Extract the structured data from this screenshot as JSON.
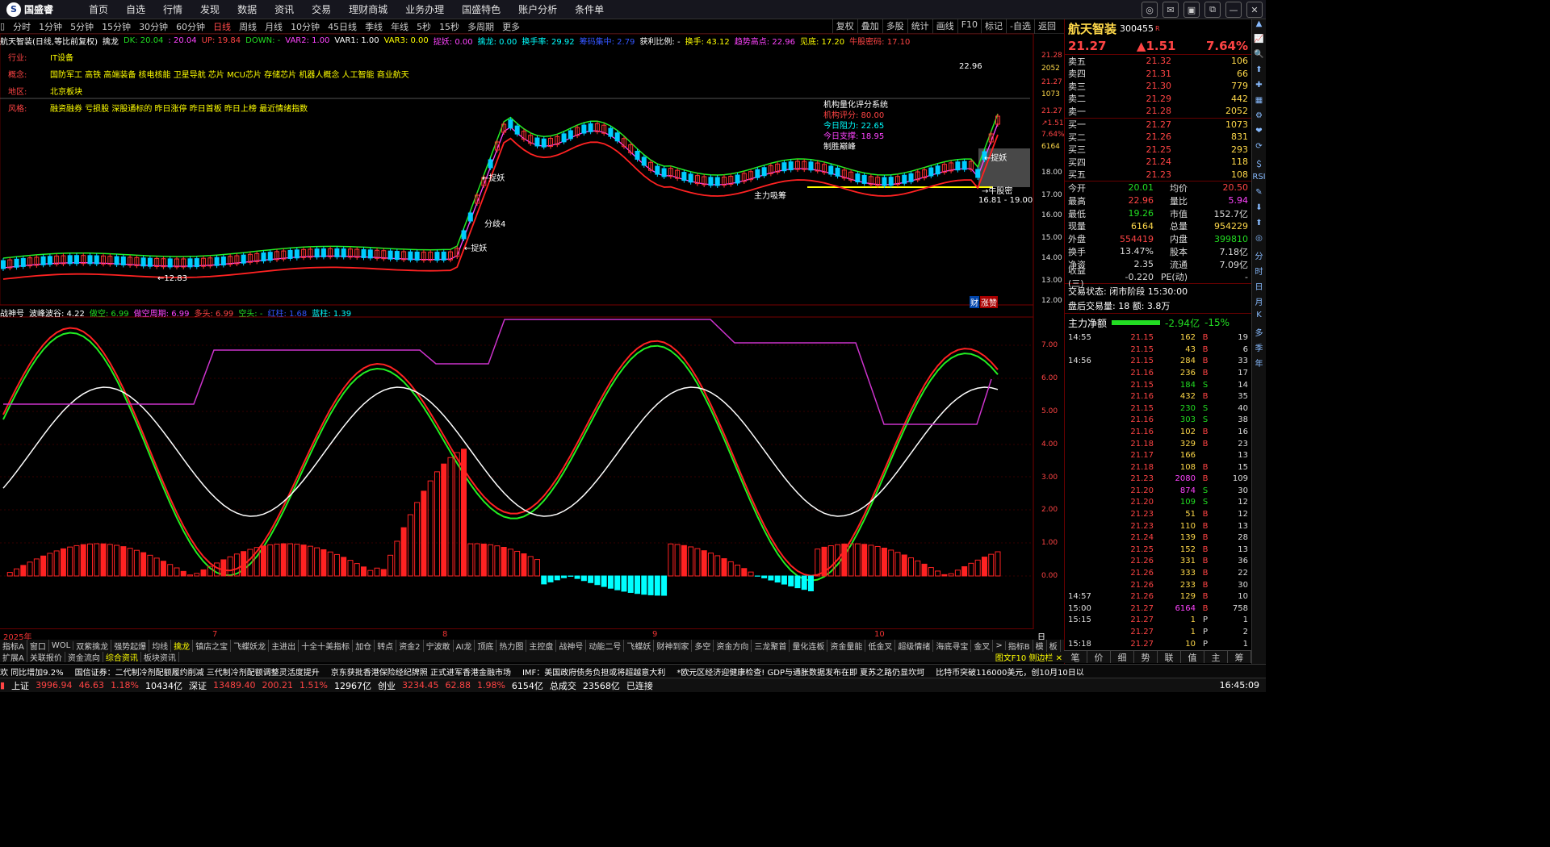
{
  "app": {
    "logo_text": "国盛睿"
  },
  "menu": [
    "首页",
    "自选",
    "行情",
    "发现",
    "数据",
    "资讯",
    "交易",
    "理财商城",
    "业务办理",
    "国盛特色",
    "账户分析",
    "条件单"
  ],
  "window_buttons": [
    "◎",
    "✉",
    "▣",
    "⧉",
    "—",
    "✕"
  ],
  "periods": [
    "分时",
    "1分钟",
    "5分钟",
    "15分钟",
    "30分钟",
    "60分钟",
    "日线",
    "周线",
    "月线",
    "10分钟",
    "45日线",
    "季线",
    "年线",
    "5秒",
    "15秒",
    "多周期",
    "更多"
  ],
  "period_active": "日线",
  "right_tools": [
    "复权",
    "叠加",
    "多股",
    "统计",
    "画线",
    "F10",
    "标记",
    "-自选",
    "返回"
  ],
  "indicator1": [
    {
      "t": "航天智装(日线,等比前复权)",
      "c": "#ffffff"
    },
    {
      "t": "擒龙",
      "c": "#ffffff"
    },
    {
      "t": "DK: 20.04",
      "c": "#22dd22"
    },
    {
      "t": ": 20.04",
      "c": "#ff44ff"
    },
    {
      "t": "UP: 19.84",
      "c": "#ff4444"
    },
    {
      "t": "DOWN: -",
      "c": "#22dd22"
    },
    {
      "t": "VAR2: 1.00",
      "c": "#ff44ff"
    },
    {
      "t": "VAR1: 1.00",
      "c": "#ffffff"
    },
    {
      "t": "VAR3: 0.00",
      "c": "#ffff00"
    },
    {
      "t": "捉妖: 0.00",
      "c": "#ff44ff"
    },
    {
      "t": "擒龙: 0.00",
      "c": "#00ffff"
    },
    {
      "t": "换手率: 29.92",
      "c": "#00ffff"
    },
    {
      "t": "筹码集中: 2.79",
      "c": "#3355ff"
    },
    {
      "t": "获利比例: -",
      "c": "#ffffff"
    },
    {
      "t": "换手: 43.12",
      "c": "#ffff00"
    },
    {
      "t": "趋势高点: 22.96",
      "c": "#ff44ff"
    },
    {
      "t": "见底: 17.20",
      "c": "#ffff00"
    },
    {
      "t": "牛股密码: 17.10",
      "c": "#ff4444"
    }
  ],
  "info": [
    {
      "k": "行业:",
      "v": "IT设备"
    },
    {
      "k": "概念:",
      "v": "国防军工 高铁 高端装备 核电核能 卫星导航 芯片 MCU芯片 存储芯片 机器人概念 人工智能 商业航天"
    },
    {
      "k": "地区:",
      "v": "北京板块"
    },
    {
      "k": "风格:",
      "v": "融资融券 亏损股 深股通标的 昨日涨停 昨日首板 昨日上榜 最近情绪指数"
    }
  ],
  "score": {
    "title": "机构量化评分系统",
    "rows": [
      {
        "k": "机构评分:",
        "v": "80.00",
        "c": "#ff4444"
      },
      {
        "k": "今日阻力:",
        "v": "22.65",
        "c": "#00ffff"
      },
      {
        "k": "今日支撑:",
        "v": "18.95",
        "c": "#ff44ff"
      }
    ],
    "footer": "制胜巅峰"
  },
  "chart_labels": {
    "zhuoyao": "←捉妖",
    "fenqi": "分歧4",
    "zhuli": "主力吸筹",
    "niugu": "→牛股密",
    "range": "16.81 - 19.00",
    "low": "←12.83",
    "high": "22.96",
    "cai": "财",
    "zhang": "涨赞"
  },
  "price_axis": [
    "21.28",
    "2052",
    "21.27",
    "1073",
    "21.27",
    "↗1.51",
    "7.64%",
    "6164",
    "18.00",
    "17.00",
    "16.00",
    "15.00",
    "14.00",
    "13.00",
    "12.00"
  ],
  "indicator2": [
    {
      "t": "战神号",
      "c": "#ffffff"
    },
    {
      "t": "波峰波谷: 4.22",
      "c": "#ffffff"
    },
    {
      "t": "做空: 6.99",
      "c": "#22dd22"
    },
    {
      "t": "做空周期: 6.99",
      "c": "#ff44ff"
    },
    {
      "t": "多头: 6.99",
      "c": "#ff4444"
    },
    {
      "t": "空头: -",
      "c": "#22dd22"
    },
    {
      "t": "红柱: 1.68",
      "c": "#3355ff"
    },
    {
      "t": "蓝柱: 1.39",
      "c": "#00ffff"
    }
  ],
  "sub_axis": [
    "7.00",
    "6.00",
    "5.00",
    "4.00",
    "3.00",
    "2.00",
    "1.00",
    "0.00"
  ],
  "date_axis": [
    "2025年",
    "7",
    "8",
    "9",
    "10"
  ],
  "date_axis_right": "日线",
  "tabs1": [
    "指标A",
    "窗口",
    "WOL",
    "双紫擒龙",
    "强势起爆",
    "均线",
    "擒龙",
    "镇店之宝",
    "飞蝶妖龙",
    "主进出",
    "十全十美指标",
    "加仓",
    "转点",
    "资金2",
    "宁波敢",
    "AI龙",
    "顶底",
    "热力图",
    "主控盘",
    "战神号",
    "动能二号",
    "飞蝶妖",
    "财神到家",
    "多空",
    "资金方向",
    "三龙聚首",
    "量化连板",
    "资金量能",
    "低金叉",
    "超级情绪",
    "海底寻宝",
    "金叉",
    ">",
    "指标B",
    "模",
    "板"
  ],
  "tabs1_active": "擒龙",
  "tabs2": [
    "扩展A",
    "关联报价",
    "资金流向",
    "综合资讯",
    "板块资讯"
  ],
  "tabs2_active": "综合资讯",
  "tabs2_right": "图文F10 侧边栏 ✕",
  "news": [
    "欢 同比增加9.2%",
    "国信证券：二代制冷剂配额履约削减 三代制冷剂配额调整灵活度提升",
    "京东获批香港保险经纪牌照 正式进军香港金融市场",
    "IMF：美国政府债务负担或将超越意大利",
    "*欧元区经济迎健康检查! GDP与通胀数据发布在即 夏苏之路仍显坎坷",
    "比特币突破116000美元，创10月10日以"
  ],
  "status": [
    {
      "t": "上证",
      "c": "#fff"
    },
    {
      "t": "3996.94",
      "c": "#ff4444"
    },
    {
      "t": "46.63",
      "c": "#ff4444"
    },
    {
      "t": "1.18%",
      "c": "#ff4444"
    },
    {
      "t": "10434亿",
      "c": "#fff"
    },
    {
      "t": "深证",
      "c": "#fff"
    },
    {
      "t": "13489.40",
      "c": "#ff4444"
    },
    {
      "t": "200.21",
      "c": "#ff4444"
    },
    {
      "t": "1.51%",
      "c": "#ff4444"
    },
    {
      "t": "12967亿",
      "c": "#fff"
    },
    {
      "t": "创业",
      "c": "#fff"
    },
    {
      "t": "3234.45",
      "c": "#ff4444"
    },
    {
      "t": "62.88",
      "c": "#ff4444"
    },
    {
      "t": "1.98%",
      "c": "#ff4444"
    },
    {
      "t": "6154亿",
      "c": "#fff"
    },
    {
      "t": "总成交",
      "c": "#fff"
    },
    {
      "t": "23568亿",
      "c": "#fff"
    },
    {
      "t": "已连接",
      "c": "#fff"
    }
  ],
  "clock": "16:45:09",
  "stock": {
    "name": "航天智装",
    "code": "300455",
    "tag": "R",
    "price": "21.27",
    "change": "▲1.51",
    "pct": "7.64%"
  },
  "sell": [
    {
      "l": "卖五",
      "p": "21.32",
      "v": "106"
    },
    {
      "l": "卖四",
      "p": "21.31",
      "v": "66"
    },
    {
      "l": "卖三",
      "p": "21.30",
      "v": "779"
    },
    {
      "l": "卖二",
      "p": "21.29",
      "v": "442"
    },
    {
      "l": "卖一",
      "p": "21.28",
      "v": "2052"
    }
  ],
  "buy": [
    {
      "l": "买一",
      "p": "21.27",
      "v": "1073"
    },
    {
      "l": "买二",
      "p": "21.26",
      "v": "831"
    },
    {
      "l": "买三",
      "p": "21.25",
      "v": "293"
    },
    {
      "l": "买四",
      "p": "21.24",
      "v": "118"
    },
    {
      "l": "买五",
      "p": "21.23",
      "v": "108"
    }
  ],
  "quote": [
    [
      {
        "t": "今开",
        "c": "#ddd"
      },
      {
        "t": "20.01",
        "c": "#22dd22"
      },
      {
        "t": "均价",
        "c": "#ddd"
      },
      {
        "t": "20.50",
        "c": "#ff4444"
      }
    ],
    [
      {
        "t": "最高",
        "c": "#ddd"
      },
      {
        "t": "22.96",
        "c": "#ff4444"
      },
      {
        "t": "量比",
        "c": "#ddd"
      },
      {
        "t": "5.94",
        "c": "#ff44ff"
      }
    ],
    [
      {
        "t": "最低",
        "c": "#ddd"
      },
      {
        "t": "19.26",
        "c": "#22dd22"
      },
      {
        "t": "市值",
        "c": "#ddd"
      },
      {
        "t": "152.7亿",
        "c": "#ddd"
      }
    ],
    [
      {
        "t": "现量",
        "c": "#ddd"
      },
      {
        "t": "6164",
        "c": "#ffd94a"
      },
      {
        "t": "总量",
        "c": "#ddd"
      },
      {
        "t": "954229",
        "c": "#ffd94a"
      }
    ],
    [
      {
        "t": "外盘",
        "c": "#ddd"
      },
      {
        "t": "554419",
        "c": "#ff4444"
      },
      {
        "t": "内盘",
        "c": "#ddd"
      },
      {
        "t": "399810",
        "c": "#22dd22"
      }
    ],
    [
      {
        "t": "换手",
        "c": "#ddd"
      },
      {
        "t": "13.47%",
        "c": "#ddd"
      },
      {
        "t": "股本",
        "c": "#ddd"
      },
      {
        "t": "7.18亿",
        "c": "#ddd"
      }
    ],
    [
      {
        "t": "净资",
        "c": "#ddd"
      },
      {
        "t": "2.35",
        "c": "#ddd"
      },
      {
        "t": "流通",
        "c": "#ddd"
      },
      {
        "t": "7.09亿",
        "c": "#ddd"
      }
    ],
    [
      {
        "t": "收益(三)",
        "c": "#ddd"
      },
      {
        "t": "-0.220",
        "c": "#ddd"
      },
      {
        "t": "PE(动)",
        "c": "#ddd"
      },
      {
        "t": "-",
        "c": "#ddd"
      }
    ]
  ],
  "trade_status": "交易状态: 闭市阶段 15:30:00",
  "after_trade": "盘后交易量: 18 额: 3.8万",
  "net_flow": {
    "label": "主力净额",
    "value": "-2.94亿",
    "pct": "-15%"
  },
  "ticks": [
    {
      "t": "14:55",
      "p": "21.15",
      "v": "162",
      "s": "B",
      "n": "19"
    },
    {
      "t": "",
      "p": "21.15",
      "v": "43",
      "s": "B",
      "n": "6"
    },
    {
      "t": "14:56",
      "p": "21.15",
      "v": "284",
      "s": "B",
      "n": "33"
    },
    {
      "t": "",
      "p": "21.16",
      "v": "236",
      "s": "B",
      "n": "17"
    },
    {
      "t": "",
      "p": "21.15",
      "v": "184",
      "s": "S",
      "n": "14"
    },
    {
      "t": "",
      "p": "21.16",
      "v": "432",
      "s": "B",
      "n": "35"
    },
    {
      "t": "",
      "p": "21.15",
      "v": "230",
      "s": "S",
      "n": "40"
    },
    {
      "t": "",
      "p": "21.16",
      "v": "303",
      "s": "S",
      "n": "38"
    },
    {
      "t": "",
      "p": "21.16",
      "v": "102",
      "s": "B",
      "n": "16"
    },
    {
      "t": "",
      "p": "21.18",
      "v": "329",
      "s": "B",
      "n": "23"
    },
    {
      "t": "",
      "p": "21.17",
      "v": "166",
      "s": "",
      "n": "13"
    },
    {
      "t": "",
      "p": "21.18",
      "v": "108",
      "s": "B",
      "n": "15"
    },
    {
      "t": "",
      "p": "21.23",
      "v": "2080",
      "s": "B",
      "n": "109"
    },
    {
      "t": "",
      "p": "21.20",
      "v": "874",
      "s": "S",
      "n": "30"
    },
    {
      "t": "",
      "p": "21.20",
      "v": "109",
      "s": "S",
      "n": "12"
    },
    {
      "t": "",
      "p": "21.23",
      "v": "51",
      "s": "B",
      "n": "12"
    },
    {
      "t": "",
      "p": "21.23",
      "v": "110",
      "s": "B",
      "n": "13"
    },
    {
      "t": "",
      "p": "21.24",
      "v": "139",
      "s": "B",
      "n": "28"
    },
    {
      "t": "",
      "p": "21.25",
      "v": "152",
      "s": "B",
      "n": "13"
    },
    {
      "t": "",
      "p": "21.26",
      "v": "331",
      "s": "B",
      "n": "36"
    },
    {
      "t": "",
      "p": "21.26",
      "v": "333",
      "s": "B",
      "n": "22"
    },
    {
      "t": "",
      "p": "21.26",
      "v": "233",
      "s": "B",
      "n": "30"
    },
    {
      "t": "14:57",
      "p": "21.26",
      "v": "129",
      "s": "B",
      "n": "10"
    },
    {
      "t": "15:00",
      "p": "21.27",
      "v": "6164",
      "s": "B",
      "n": "758"
    },
    {
      "t": "15:15",
      "p": "21.27",
      "v": "1",
      "s": "P",
      "n": "1"
    },
    {
      "t": "",
      "p": "21.27",
      "v": "1",
      "s": "P",
      "n": "2"
    },
    {
      "t": "15:18",
      "p": "21.27",
      "v": "10",
      "s": "P",
      "n": "1"
    }
  ],
  "rtabs": [
    "笔",
    "价",
    "细",
    "势",
    "联",
    "值",
    "主",
    "筹"
  ],
  "vside": [
    "▲",
    "📈",
    "🔍",
    "⬆",
    "✚",
    "▦",
    "⚙",
    "❤",
    "⟳",
    "＄",
    "RSI",
    "✎",
    "⬇",
    "⬆",
    "◎",
    "分",
    "时",
    "日",
    "月",
    "K",
    "多",
    "季",
    "年"
  ],
  "colors": {
    "up": "#ff4444",
    "down": "#22dd22",
    "accent": "#ffd94a"
  }
}
